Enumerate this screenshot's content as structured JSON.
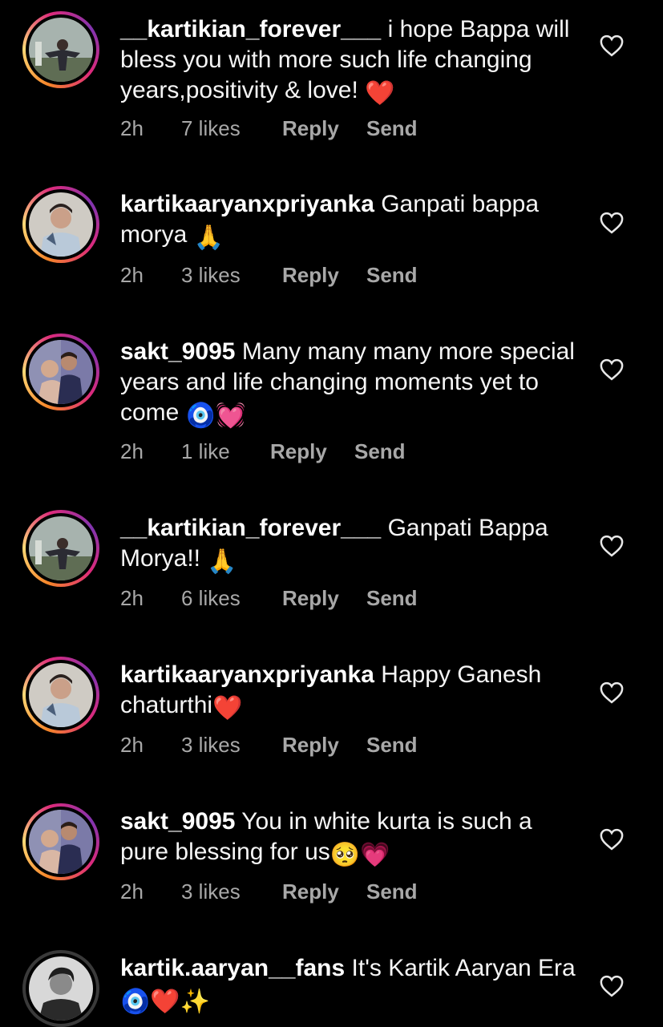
{
  "comments": [
    {
      "username": "__kartikian_forever___",
      "text": "i hope Bappa will bless you with more such life changing years,positivity & love!",
      "emoji": "❤️",
      "time": "2h",
      "likes": "7 likes",
      "reply": "Reply",
      "send": "Send"
    },
    {
      "username": "kartikaaryanxpriyanka",
      "text": "Ganpati bappa morya",
      "emoji": "🙏",
      "time": "2h",
      "likes": "3 likes",
      "reply": "Reply",
      "send": "Send"
    },
    {
      "username": "sakt_9095",
      "text": "Many many many more special years and life changing moments yet to come",
      "emoji": "🧿💓",
      "time": "2h",
      "likes": "1 like",
      "reply": "Reply",
      "send": "Send"
    },
    {
      "username": "__kartikian_forever___",
      "text": "Ganpati Bappa Morya!!",
      "emoji": "🙏",
      "time": "2h",
      "likes": "6 likes",
      "reply": "Reply",
      "send": "Send"
    },
    {
      "username": "kartikaaryanxpriyanka",
      "text": "Happy Ganesh chaturthi",
      "emoji": "❤️",
      "time": "2h",
      "likes": "3 likes",
      "reply": "Reply",
      "send": "Send"
    },
    {
      "username": "sakt_9095",
      "text": "You in white kurta is such a pure blessing for us",
      "emoji": "🥺💗",
      "time": "2h",
      "likes": "3 likes",
      "reply": "Reply",
      "send": "Send"
    },
    {
      "username": "kartik.aaryan__fans",
      "text": "It's Kartik Aaryan Era",
      "emoji": "🧿❤️✨",
      "time": "",
      "likes": "",
      "reply": "",
      "send": ""
    }
  ],
  "icons": {
    "like": "heart-outline-icon"
  },
  "colors": {
    "background": "#000000",
    "text": "#f5f5f5",
    "meta": "#a8a8a8",
    "ring_start": "#f58529",
    "ring_end": "#dd2a7b"
  }
}
